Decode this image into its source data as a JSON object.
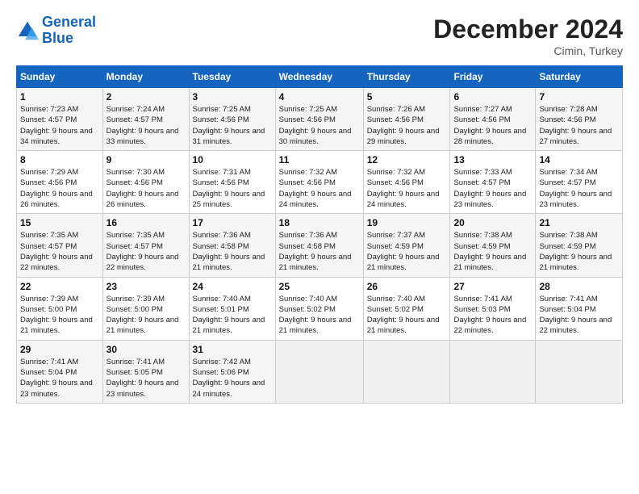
{
  "logo": {
    "line1": "General",
    "line2": "Blue"
  },
  "title": "December 2024",
  "location": "Cimin, Turkey",
  "days_of_week": [
    "Sunday",
    "Monday",
    "Tuesday",
    "Wednesday",
    "Thursday",
    "Friday",
    "Saturday"
  ],
  "weeks": [
    [
      {
        "day": "1",
        "sunrise": "Sunrise: 7:23 AM",
        "sunset": "Sunset: 4:57 PM",
        "daylight": "Daylight: 9 hours and 34 minutes."
      },
      {
        "day": "2",
        "sunrise": "Sunrise: 7:24 AM",
        "sunset": "Sunset: 4:57 PM",
        "daylight": "Daylight: 9 hours and 33 minutes."
      },
      {
        "day": "3",
        "sunrise": "Sunrise: 7:25 AM",
        "sunset": "Sunset: 4:56 PM",
        "daylight": "Daylight: 9 hours and 31 minutes."
      },
      {
        "day": "4",
        "sunrise": "Sunrise: 7:25 AM",
        "sunset": "Sunset: 4:56 PM",
        "daylight": "Daylight: 9 hours and 30 minutes."
      },
      {
        "day": "5",
        "sunrise": "Sunrise: 7:26 AM",
        "sunset": "Sunset: 4:56 PM",
        "daylight": "Daylight: 9 hours and 29 minutes."
      },
      {
        "day": "6",
        "sunrise": "Sunrise: 7:27 AM",
        "sunset": "Sunset: 4:56 PM",
        "daylight": "Daylight: 9 hours and 28 minutes."
      },
      {
        "day": "7",
        "sunrise": "Sunrise: 7:28 AM",
        "sunset": "Sunset: 4:56 PM",
        "daylight": "Daylight: 9 hours and 27 minutes."
      }
    ],
    [
      {
        "day": "8",
        "sunrise": "Sunrise: 7:29 AM",
        "sunset": "Sunset: 4:56 PM",
        "daylight": "Daylight: 9 hours and 26 minutes."
      },
      {
        "day": "9",
        "sunrise": "Sunrise: 7:30 AM",
        "sunset": "Sunset: 4:56 PM",
        "daylight": "Daylight: 9 hours and 26 minutes."
      },
      {
        "day": "10",
        "sunrise": "Sunrise: 7:31 AM",
        "sunset": "Sunset: 4:56 PM",
        "daylight": "Daylight: 9 hours and 25 minutes."
      },
      {
        "day": "11",
        "sunrise": "Sunrise: 7:32 AM",
        "sunset": "Sunset: 4:56 PM",
        "daylight": "Daylight: 9 hours and 24 minutes."
      },
      {
        "day": "12",
        "sunrise": "Sunrise: 7:32 AM",
        "sunset": "Sunset: 4:56 PM",
        "daylight": "Daylight: 9 hours and 24 minutes."
      },
      {
        "day": "13",
        "sunrise": "Sunrise: 7:33 AM",
        "sunset": "Sunset: 4:57 PM",
        "daylight": "Daylight: 9 hours and 23 minutes."
      },
      {
        "day": "14",
        "sunrise": "Sunrise: 7:34 AM",
        "sunset": "Sunset: 4:57 PM",
        "daylight": "Daylight: 9 hours and 23 minutes."
      }
    ],
    [
      {
        "day": "15",
        "sunrise": "Sunrise: 7:35 AM",
        "sunset": "Sunset: 4:57 PM",
        "daylight": "Daylight: 9 hours and 22 minutes."
      },
      {
        "day": "16",
        "sunrise": "Sunrise: 7:35 AM",
        "sunset": "Sunset: 4:57 PM",
        "daylight": "Daylight: 9 hours and 22 minutes."
      },
      {
        "day": "17",
        "sunrise": "Sunrise: 7:36 AM",
        "sunset": "Sunset: 4:58 PM",
        "daylight": "Daylight: 9 hours and 21 minutes."
      },
      {
        "day": "18",
        "sunrise": "Sunrise: 7:36 AM",
        "sunset": "Sunset: 4:58 PM",
        "daylight": "Daylight: 9 hours and 21 minutes."
      },
      {
        "day": "19",
        "sunrise": "Sunrise: 7:37 AM",
        "sunset": "Sunset: 4:59 PM",
        "daylight": "Daylight: 9 hours and 21 minutes."
      },
      {
        "day": "20",
        "sunrise": "Sunrise: 7:38 AM",
        "sunset": "Sunset: 4:59 PM",
        "daylight": "Daylight: 9 hours and 21 minutes."
      },
      {
        "day": "21",
        "sunrise": "Sunrise: 7:38 AM",
        "sunset": "Sunset: 4:59 PM",
        "daylight": "Daylight: 9 hours and 21 minutes."
      }
    ],
    [
      {
        "day": "22",
        "sunrise": "Sunrise: 7:39 AM",
        "sunset": "Sunset: 5:00 PM",
        "daylight": "Daylight: 9 hours and 21 minutes."
      },
      {
        "day": "23",
        "sunrise": "Sunrise: 7:39 AM",
        "sunset": "Sunset: 5:00 PM",
        "daylight": "Daylight: 9 hours and 21 minutes."
      },
      {
        "day": "24",
        "sunrise": "Sunrise: 7:40 AM",
        "sunset": "Sunset: 5:01 PM",
        "daylight": "Daylight: 9 hours and 21 minutes."
      },
      {
        "day": "25",
        "sunrise": "Sunrise: 7:40 AM",
        "sunset": "Sunset: 5:02 PM",
        "daylight": "Daylight: 9 hours and 21 minutes."
      },
      {
        "day": "26",
        "sunrise": "Sunrise: 7:40 AM",
        "sunset": "Sunset: 5:02 PM",
        "daylight": "Daylight: 9 hours and 21 minutes."
      },
      {
        "day": "27",
        "sunrise": "Sunrise: 7:41 AM",
        "sunset": "Sunset: 5:03 PM",
        "daylight": "Daylight: 9 hours and 22 minutes."
      },
      {
        "day": "28",
        "sunrise": "Sunrise: 7:41 AM",
        "sunset": "Sunset: 5:04 PM",
        "daylight": "Daylight: 9 hours and 22 minutes."
      }
    ],
    [
      {
        "day": "29",
        "sunrise": "Sunrise: 7:41 AM",
        "sunset": "Sunset: 5:04 PM",
        "daylight": "Daylight: 9 hours and 23 minutes."
      },
      {
        "day": "30",
        "sunrise": "Sunrise: 7:41 AM",
        "sunset": "Sunset: 5:05 PM",
        "daylight": "Daylight: 9 hours and 23 minutes."
      },
      {
        "day": "31",
        "sunrise": "Sunrise: 7:42 AM",
        "sunset": "Sunset: 5:06 PM",
        "daylight": "Daylight: 9 hours and 24 minutes."
      },
      null,
      null,
      null,
      null
    ]
  ]
}
